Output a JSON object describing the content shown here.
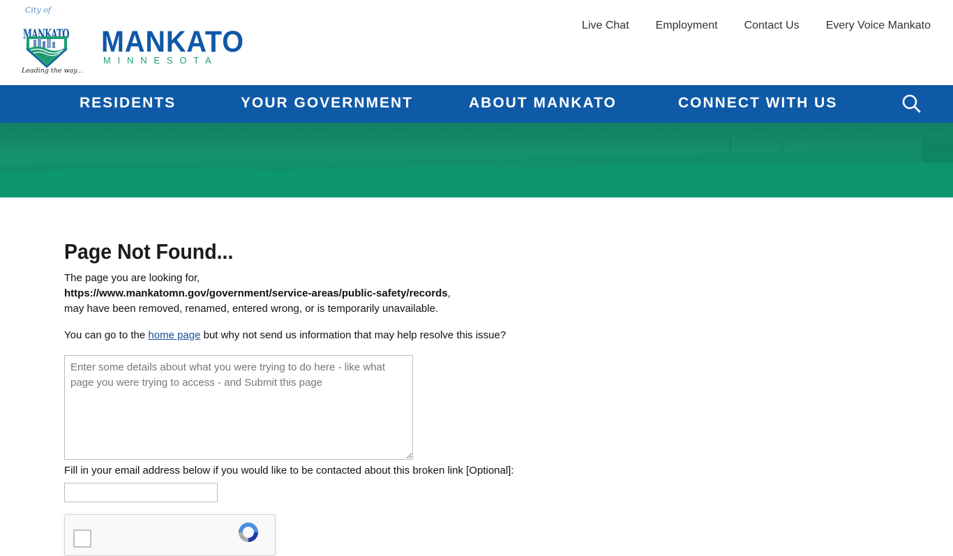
{
  "header": {
    "seal": {
      "script_text": "City of",
      "name": "MANKATO",
      "motto": "Leading the way..."
    },
    "wordmark": {
      "title": "MANKATO",
      "subtitle": "MINNESOTA"
    },
    "utility_links": [
      "Live Chat",
      "Employment",
      "Contact Us",
      "Every Voice Mankato"
    ]
  },
  "main_nav": {
    "items": [
      "RESIDENTS",
      "YOUR GOVERNMENT",
      "ABOUT MANKATO",
      "CONNECT WITH US"
    ],
    "search_icon": "search-icon"
  },
  "content": {
    "title": "Page Not Found...",
    "intro": "The page you are looking for,",
    "missing_url": "https://www.mankatomn.gov/government/service-areas/public-safety/records",
    "missing_url_suffix": ",",
    "reason": "may have been removed, renamed, entered wrong, or is temporarily unavailable.",
    "suggestion_prefix": "You can go to the ",
    "home_link": "home page",
    "suggestion_suffix": " but why not send us information that may help resolve this issue?",
    "details_placeholder": "Enter some details about what you were trying to do here - like what page you were trying to access - and Submit this page",
    "details_value": "",
    "email_label": "Fill in your email address below if you would like to be contacted about this broken link [Optional]:",
    "email_value": ""
  },
  "colors": {
    "brand_blue": "#0f5aa7",
    "brand_green": "#1a9e77",
    "banner_green": "#0a9d70",
    "link_blue": "#1a4f9c"
  }
}
